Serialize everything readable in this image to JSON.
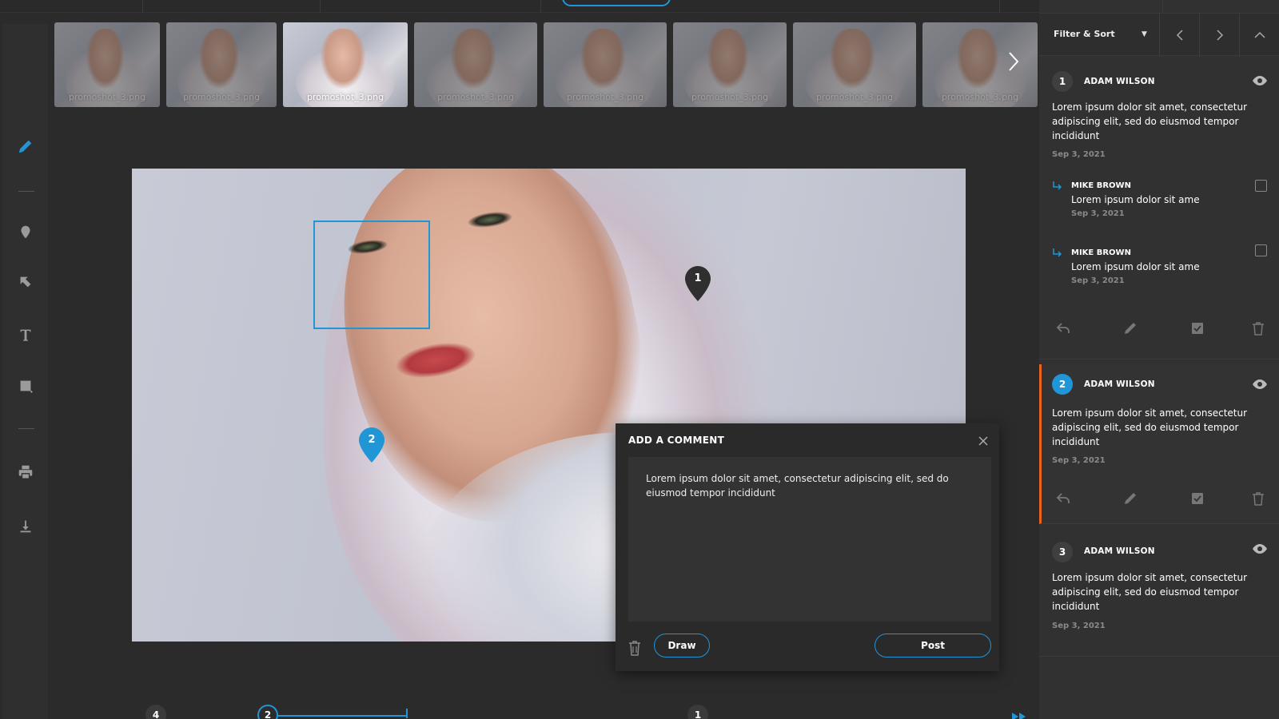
{
  "thumbnails": [
    {
      "label": "promoshot_3.png"
    },
    {
      "label": "promoshot_3.png"
    },
    {
      "label": "promoshot_3.png"
    },
    {
      "label": "promoshot_3.png"
    },
    {
      "label": "promoshot_3.png"
    },
    {
      "label": "promoshot_3.png"
    },
    {
      "label": "promoshot_3.png"
    },
    {
      "label": "promoshot_3.png"
    }
  ],
  "pins": [
    {
      "number": "1"
    },
    {
      "number": "2"
    }
  ],
  "dialog": {
    "title": "ADD A COMMENT",
    "text": "Lorem ipsum dolor sit amet, consectetur adipiscing elit, sed do eiusmod tempor incididunt",
    "draw_label": "Draw",
    "post_label": "Post"
  },
  "timeline": {
    "markers": [
      "4",
      "2",
      "1"
    ]
  },
  "panel": {
    "filter_label": "Filter & Sort",
    "comments": [
      {
        "number": "1",
        "author": "ADAM WILSON",
        "text": "Lorem ipsum dolor sit amet, consectetur adipiscing elit, sed do eiusmod tempor incididunt",
        "date": "Sep 3, 2021",
        "replies": [
          {
            "author": "MIKE BROWN",
            "text": "Lorem ipsum dolor sit ame",
            "date": "Sep 3, 2021"
          },
          {
            "author": "MIKE BROWN",
            "text": "Lorem ipsum dolor sit ame",
            "date": "Sep 3, 2021"
          }
        ]
      },
      {
        "number": "2",
        "author": "ADAM WILSON",
        "text": "Lorem ipsum dolor sit amet, consectetur adipiscing elit, sed do eiusmod tempor incididunt",
        "date": "Sep 3, 2021"
      },
      {
        "number": "3",
        "author": "ADAM WILSON",
        "text": "Lorem ipsum dolor sit amet, consectetur adipiscing elit, sed do eiusmod tempor incididunt",
        "date": "Sep 3, 2021"
      }
    ]
  },
  "colors": {
    "accent": "#2196d6",
    "active_marker": "#e8641c",
    "background": "#2b2b2b"
  }
}
